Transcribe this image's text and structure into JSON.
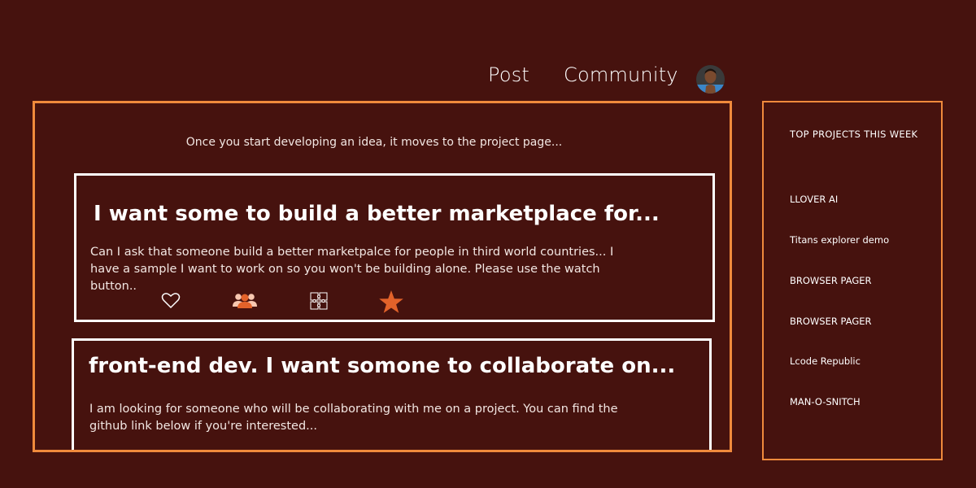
{
  "nav": {
    "post_label": "Post",
    "community_label": "Community"
  },
  "feed": {
    "intro_text": "Once you start developing an idea, it moves to the project page...",
    "posts": [
      {
        "title": "I want some to build a better marketplace for...",
        "body": "Can I ask that someone build a better marketpalce for people in third world countries... I have a sample I want to work on so you won't be building alone. Please use the watch button..",
        "actions": [
          "heart-icon",
          "group-icon",
          "puzzle-icon",
          "star-icon"
        ]
      },
      {
        "title": "front-end dev. I want somone to collaborate on...",
        "body": "I am looking for someone who will be collaborating with me on a project. You can find the github link below if you're interested..."
      }
    ]
  },
  "sidebar": {
    "title": "TOP PROJECTS THIS WEEK",
    "items": [
      {
        "label": "LLOVER AI"
      },
      {
        "label": "Titans explorer demo"
      },
      {
        "label": "BROWSER PAGER"
      },
      {
        "label": "BROWSER PAGER"
      },
      {
        "label": "Lcode Republic"
      },
      {
        "label": "MAN-O-SNITCH"
      }
    ]
  },
  "colors": {
    "background": "#46120e",
    "accent": "#f08a3c",
    "icon_orange": "#e2622a"
  }
}
